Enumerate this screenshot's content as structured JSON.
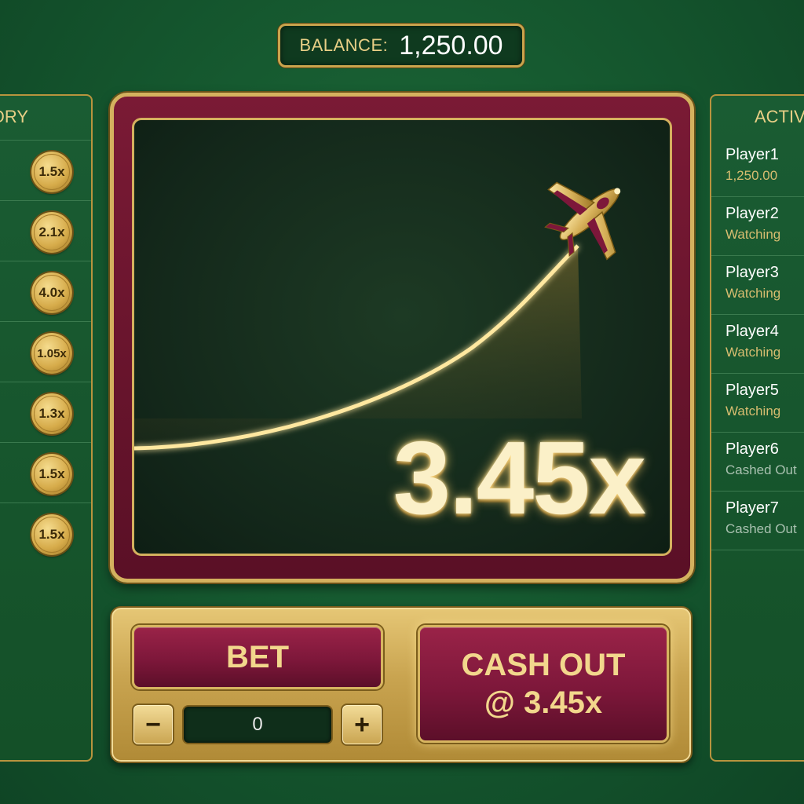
{
  "balance": {
    "label": "BALANCE:",
    "value": "1,250.00"
  },
  "history": {
    "title": "ORY",
    "items": [
      "1.5x",
      "2.1x",
      "4.0x",
      "1.05x",
      "1.3x",
      "1.5x",
      "1.5x"
    ]
  },
  "players": {
    "title": "ACTIV",
    "items": [
      {
        "name": "Player1",
        "status": "1,250.00",
        "state": "gold"
      },
      {
        "name": "Player2",
        "status": "Watching",
        "state": "gold"
      },
      {
        "name": "Player3",
        "status": "Watching",
        "state": "gold"
      },
      {
        "name": "Player4",
        "status": "Watching",
        "state": "gold"
      },
      {
        "name": "Player5",
        "status": "Watching",
        "state": "gold"
      },
      {
        "name": "Player6",
        "status": "Cashed Out",
        "state": "grey"
      },
      {
        "name": "Player7",
        "status": "Cashed Out",
        "state": "grey"
      }
    ]
  },
  "game": {
    "multiplier": "3.45x",
    "plane_icon": "airplane-icon"
  },
  "controls": {
    "bet_label": "BET",
    "cashout_line1": "CASH OUT",
    "cashout_line2": "@ 3.45x",
    "minus_label": "−",
    "plus_label": "+",
    "bet_amount": "0"
  },
  "colors": {
    "table_green": "#165a30",
    "gold": "#c9a44d",
    "maroon": "#7d173a",
    "screen_dark": "#13271a"
  }
}
